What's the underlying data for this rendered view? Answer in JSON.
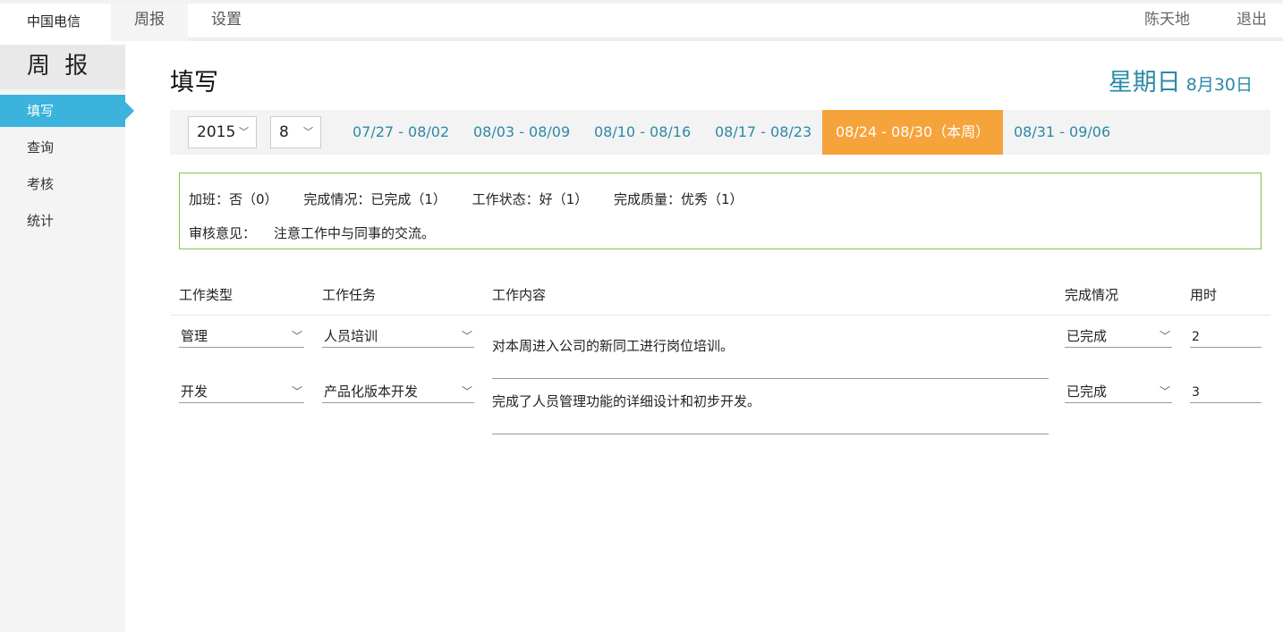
{
  "topbar": {
    "brand": "中国电信",
    "nav": [
      "周报",
      "设置"
    ],
    "user": "陈天地",
    "logout": "退出"
  },
  "sidebar": {
    "title": "周 报",
    "items": [
      "填写",
      "查询",
      "考核",
      "统计"
    ],
    "active_index": 0
  },
  "main": {
    "title": "填写",
    "weekday": "星期日",
    "date": "8月30日",
    "year_select": "2015",
    "month_select": "8",
    "weeks": [
      "07/27 - 08/02",
      "08/03 - 08/09",
      "08/10 - 08/16",
      "08/17 - 08/23",
      "08/24 - 08/30（本周）",
      "08/31 - 09/06"
    ],
    "active_week_index": 4
  },
  "review": {
    "overtime": "加班：否（0）",
    "completion": "完成情况：已完成（1）",
    "work_status": "工作状态：好（1）",
    "quality": "完成质量：优秀（1）",
    "opinion_label": "审核意见：",
    "opinion_value": "注意工作中与同事的交流。"
  },
  "table": {
    "headers": [
      "工作类型",
      "工作任务",
      "工作内容",
      "完成情况",
      "用时"
    ],
    "rows": [
      {
        "type": "管理",
        "task": "人员培训",
        "content": "对本周进入公司的新同工进行岗位培训。",
        "status": "已完成",
        "hours": "2"
      },
      {
        "type": "开发",
        "task": "产品化版本开发",
        "content": "完成了人员管理功能的详细设计和初步开发。",
        "status": "已完成",
        "hours": "3"
      }
    ]
  },
  "colors": {
    "accent_blue": "#3bb3dc",
    "link_teal": "#2a8aa8",
    "active_orange": "#f7a33c",
    "review_border": "#7cc84a"
  }
}
